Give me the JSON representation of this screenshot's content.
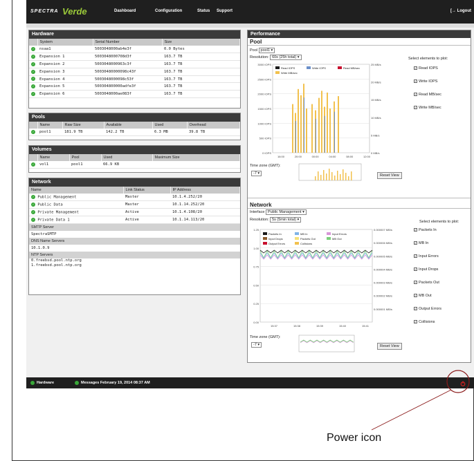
{
  "app": {
    "logo_prefix": "SPECTRA",
    "logo_name": "Verde",
    "nav": [
      "Dashboard",
      "Configuration",
      "Status",
      "Support"
    ],
    "logout": "Logout"
  },
  "hardware": {
    "title": "Hardware",
    "columns": [
      "System",
      "Serial Number",
      "Size"
    ],
    "rows": [
      [
        "nsaa1",
        "5003048000ab4e3f",
        "0.0 Bytes"
      ],
      [
        "Expansion 1",
        "5003048000708d3f",
        "163.7 TB"
      ],
      [
        "Expansion 2",
        "5003048000963c3f",
        "163.7 TB"
      ],
      [
        "Expansion 3",
        "50030480000098c43f",
        "163.7 TB"
      ],
      [
        "Expansion 4",
        "5003048000098c53f",
        "163.7 TB"
      ],
      [
        "Expansion 5",
        "500304800000adfe3f",
        "163.7 TB"
      ],
      [
        "Expansion 6",
        "5003048000ae083f",
        "163.7 TB"
      ]
    ]
  },
  "pools": {
    "title": "Pools",
    "columns": [
      "Name",
      "Raw Size",
      "Available",
      "Used",
      "Overhead"
    ],
    "rows": [
      [
        "pool1",
        "181.9 TB",
        "142.2 TB",
        "6.3 MB",
        "39.8 TB"
      ]
    ]
  },
  "volumes": {
    "title": "Volumes",
    "columns": [
      "Name",
      "Pool",
      "Used",
      "Maximum Size"
    ],
    "rows": [
      [
        "vol1",
        "pool1",
        "66.9 KB",
        ""
      ]
    ]
  },
  "network": {
    "title": "Network",
    "columns": [
      "Name",
      "Link Status",
      "IP Address"
    ],
    "rows": [
      [
        "Public Management",
        "Master",
        "10.1.4.252/20"
      ],
      [
        "Public Data",
        "Master",
        "10.1.14.252/20"
      ],
      [
        "Private Management",
        "Active",
        "10.1.4.108/20"
      ],
      [
        "Private Data 1",
        "Active",
        "10.1.14.113/20"
      ]
    ],
    "smtp_label": "SMTP Server",
    "smtp_value": "SpectraSMTP",
    "dns_label": "DNS Name Servers",
    "dns_value": "10.1.0.9",
    "ntp_label": "NTP Servers",
    "ntp_values": [
      "0.freebsd.pool.ntp.org",
      "1.freebsd.pool.ntp.org"
    ]
  },
  "performance": {
    "title": "Performance",
    "pool_section": {
      "title": "Pool",
      "pool_label": "Pool",
      "pool_value": "pool1",
      "resolution_label": "Resolution:",
      "resolution_value": "60s (25h total)",
      "select_label": "Select elements to plot:",
      "checks": [
        "Read IOPS",
        "Write IOPS",
        "Read MB/sec",
        "Write MB/sec"
      ],
      "legend": [
        "Read IOPS",
        "Write IOPS",
        "Read MB/sec",
        "Write MB/sec"
      ],
      "y_left": [
        "3000 IOPS",
        "2500 IOPS",
        "2000 IOPS",
        "1500 IOPS",
        "1000 IOPS",
        "500 IOPS",
        "0 IOPS"
      ],
      "y_right": [
        "25 MB/s",
        "20 MB/s",
        "15 MB/s",
        "10 MB/s",
        "5 MB/s",
        "0 MB/s"
      ],
      "x_ticks": [
        "16:00",
        "20:00",
        "00:00",
        "04:00",
        "08:00",
        "12:00"
      ],
      "timezone_label": "Time zone (GMT):",
      "timezone_value": "-7",
      "reset": "Reset View"
    },
    "net_section": {
      "title": "Network",
      "interface_label": "Interface",
      "interface_value": "Public Management",
      "resolution_label": "Resolution:",
      "resolution_value": "5s (5min total)",
      "select_label": "Select elements to plot:",
      "checks": [
        "Packets In",
        "MB In",
        "Input Errors",
        "Input Drops",
        "Packets Out",
        "MB Out",
        "Output Errors",
        "Collisions"
      ],
      "legend": [
        "Packets In",
        "MB In",
        "Input Errors",
        "Input Drops",
        "Packets Out",
        "MB Out",
        "Output Errors",
        "Collisions"
      ],
      "y_left": [
        "1.25",
        "1.00",
        "0.75",
        "0.50",
        "0.25",
        "0.00"
      ],
      "y_right": [
        "0.000007 MB/s",
        "0.000006 MB/s",
        "0.000005 MB/s",
        "0.000004 MB/s",
        "0.000003 MB/s",
        "0.000002 MB/s",
        "0.000001 MB/s"
      ],
      "x_ticks": [
        "15:37",
        "15:38",
        "15:39",
        "15:40",
        "15:41"
      ],
      "timezone_label": "Time zone (GMT):",
      "timezone_value": "-7",
      "reset": "Reset View"
    }
  },
  "footer": {
    "hardware": "Hardware",
    "messages": "Messages February 19, 2014 08:37 AM"
  },
  "callout": "Power icon",
  "colors": {
    "header": "#1f1f1f",
    "accent_green": "#9ccb3a",
    "status_ok": "#39a839",
    "power_red": "#c62020",
    "read_iops": "#1a1a1a",
    "write_iops": "#6b8fc9",
    "read_mb": "#c8102e",
    "write_mb": "#f2c14e"
  }
}
